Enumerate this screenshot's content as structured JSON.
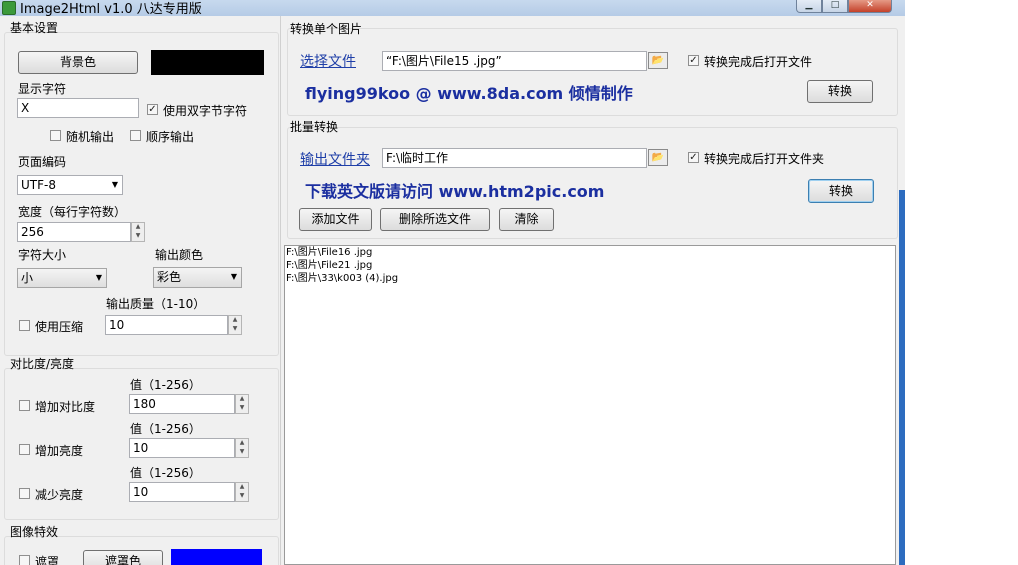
{
  "window": {
    "title": "Image2Html v1.0 八达专用版",
    "caption": {
      "min": "▁",
      "max": "□",
      "close": "✕"
    }
  },
  "basic": {
    "heading": "基本设置",
    "bg_button": "背景色",
    "bg_color": "#000000",
    "display_chars_label": "显示字符",
    "display_chars_value": "X",
    "double_byte_label": "使用双字节字符",
    "random_label": "随机输出",
    "sequential_label": "顺序输出",
    "encoding_label": "页面编码",
    "encoding_value": "UTF-8",
    "width_label": "宽度（每行字符数）",
    "width_value": "256",
    "font_size_label": "字符大小",
    "font_size_value": "小",
    "output_color_label": "输出颜色",
    "output_color_value": "彩色",
    "quality_label": "输出质量（1-10）",
    "compress_label": "使用压缩",
    "quality_value": "10"
  },
  "contrast": {
    "heading": "对比度/亮度",
    "range_label": "值（1-256）",
    "increase_contrast_label": "增加对比度",
    "increase_contrast_value": "180",
    "increase_brightness_label": "增加亮度",
    "increase_brightness_value": "10",
    "decrease_brightness_label": "减少亮度",
    "decrease_brightness_value": "10"
  },
  "effects": {
    "heading": "图像特效",
    "mask_label": "遮罩",
    "mask_button": "遮罩色",
    "mask_color": "#0000ff"
  },
  "single": {
    "heading": "转换单个图片",
    "select_file_link": "选择文件",
    "file_path": "“F:\\图片\\File15 .jpg”",
    "open_after_label": "转换完成后打开文件",
    "credit": "flying99koo @ www.8da.com 倾情制作",
    "convert_button": "转换"
  },
  "batch": {
    "heading": "批量转换",
    "output_folder_link": "输出文件夹",
    "folder_path": "F:\\临时工作",
    "open_after_label": "转换完成后打开文件夹",
    "download_note": "下载英文版请访问 www.htm2pic.com",
    "convert_button": "转换",
    "add_files_button": "添加文件",
    "delete_selected_button": "删除所选文件",
    "clear_button": "清除",
    "files": [
      "F:\\图片\\File16 .jpg",
      "F:\\图片\\File21 .jpg",
      "F:\\图片\\33\\k003 (4).jpg"
    ]
  },
  "icons": {
    "folder": "📂",
    "check": "✓",
    "dropdown": "▼",
    "spin_up": "▲",
    "spin_down": "▼"
  }
}
